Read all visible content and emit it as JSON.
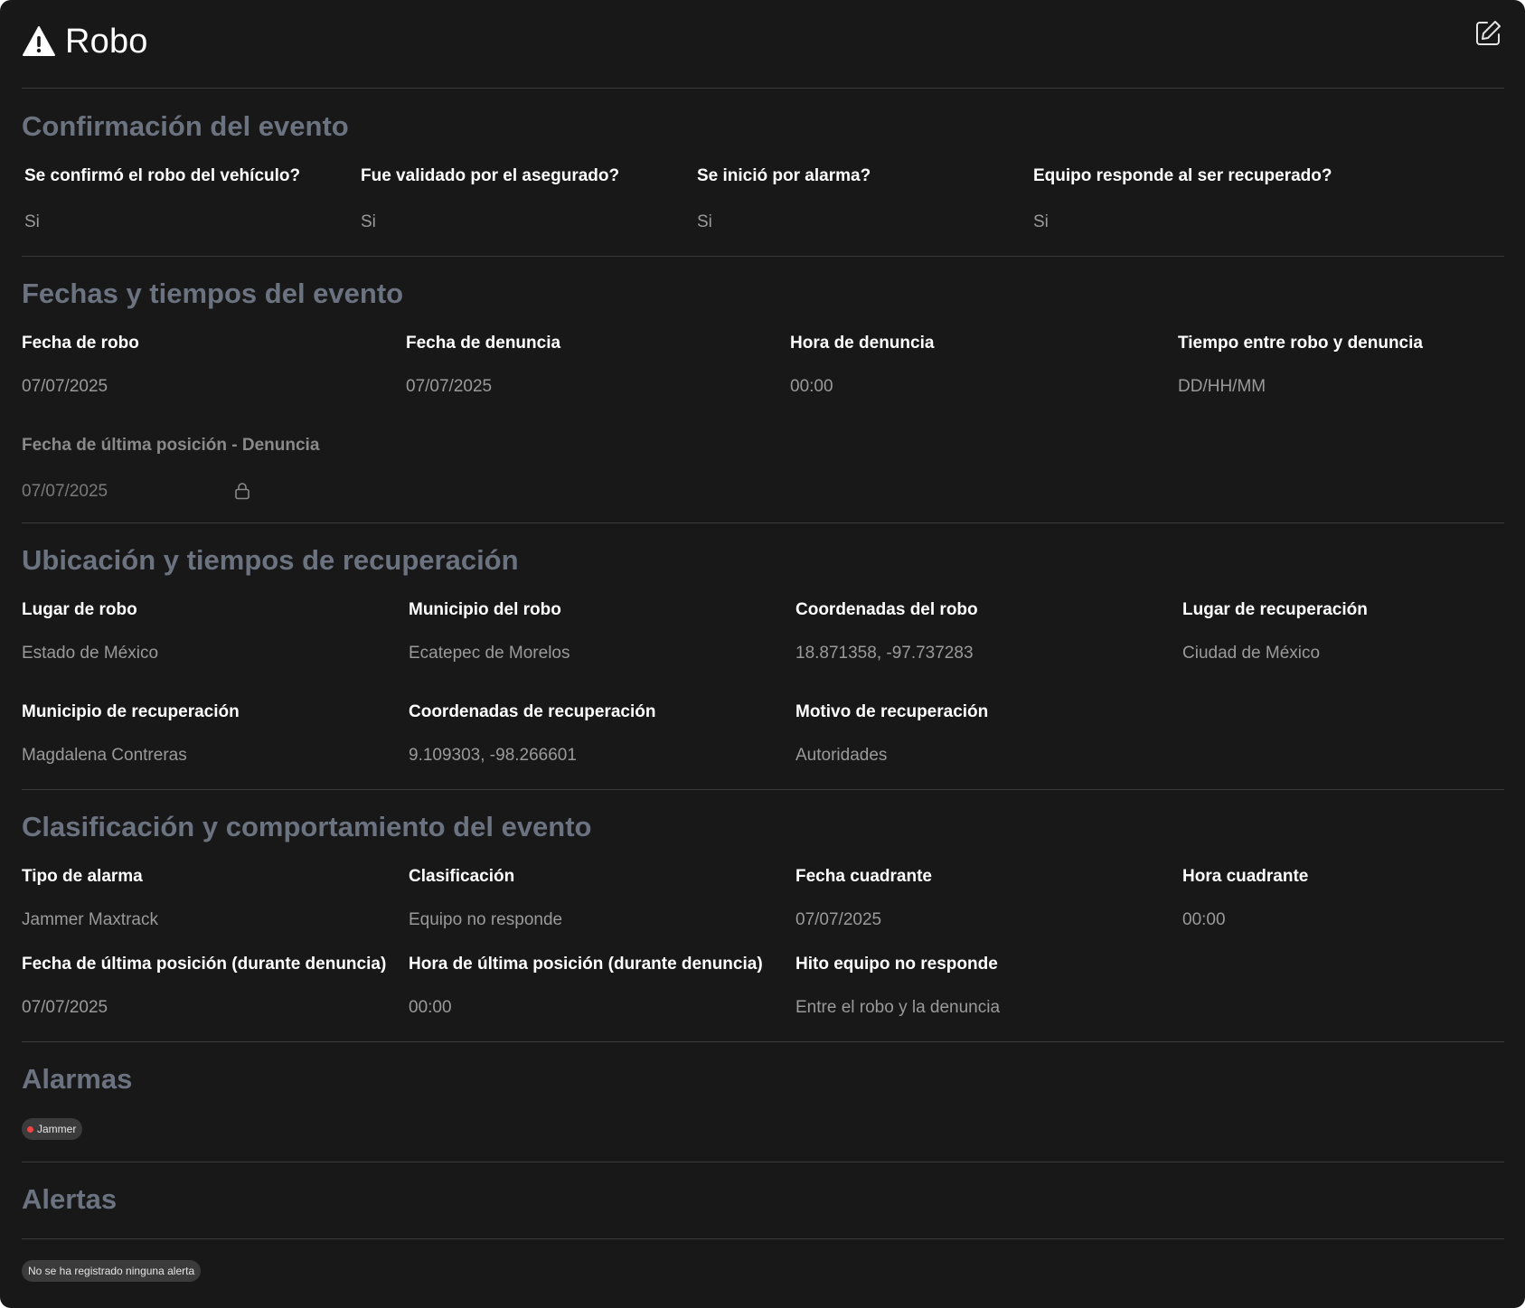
{
  "header": {
    "title": "Robo",
    "icon": "warning-icon",
    "edit_icon": "edit-icon"
  },
  "confirmacion": {
    "title": "Confirmación del evento",
    "fields": [
      {
        "label": "Se confirmó el robo del vehículo?",
        "value": "Si"
      },
      {
        "label": "Fue validado por el asegurado?",
        "value": "Si"
      },
      {
        "label": "Se inició por alarma?",
        "value": "Si"
      },
      {
        "label": "Equipo responde al ser recuperado?",
        "value": "Si"
      }
    ]
  },
  "fechas": {
    "title": "Fechas y tiempos del evento",
    "fields": [
      {
        "label": "Fecha de robo",
        "value": "07/07/2025"
      },
      {
        "label": "Fecha de denuncia",
        "value": "07/07/2025"
      },
      {
        "label": "Hora de denuncia",
        "value": "00:00"
      },
      {
        "label": "Tiempo entre robo y denuncia",
        "value": "DD/HH/MM"
      }
    ],
    "locked_field": {
      "label": "Fecha de última posición - Denuncia",
      "value": "07/07/2025",
      "icon": "lock-icon"
    }
  },
  "ubicacion": {
    "title": "Ubicación y tiempos de recuperación",
    "fields": [
      {
        "label": "Lugar de robo",
        "value": "Estado de México"
      },
      {
        "label": "Municipio del robo",
        "value": "Ecatepec de Morelos"
      },
      {
        "label": "Coordenadas del robo",
        "value": "18.871358, -97.737283"
      },
      {
        "label": "Lugar de recuperación",
        "value": "Ciudad de México"
      },
      {
        "label": "Municipio de recuperación",
        "value": "Magdalena Contreras"
      },
      {
        "label": "Coordenadas de recuperación",
        "value": "9.109303, -98.266601"
      },
      {
        "label": "Motivo de recuperación",
        "value": "Autoridades"
      }
    ]
  },
  "clasificacion": {
    "title": "Clasificación y comportamiento del evento",
    "fields": [
      {
        "label": "Tipo de alarma",
        "value": "Jammer Maxtrack"
      },
      {
        "label": "Clasificación",
        "value": "Equipo no responde"
      },
      {
        "label": "Fecha cuadrante",
        "value": "07/07/2025"
      },
      {
        "label": "Hora cuadrante",
        "value": "00:00"
      },
      {
        "label": "Fecha de última posición (durante denuncia)",
        "value": "07/07/2025"
      },
      {
        "label": "Hora de última posición (durante denuncia)",
        "value": "00:00"
      },
      {
        "label": "Hito equipo no responde",
        "value": "Entre el robo y la denuncia"
      }
    ]
  },
  "alarmas": {
    "title": "Alarmas",
    "chips": [
      {
        "label": "Jammer",
        "dot_color": "#ef4444"
      }
    ]
  },
  "alertas": {
    "title": "Alertas",
    "empty_text": "No se ha registrado ninguna alerta"
  },
  "colors": {
    "background": "#181818",
    "section_title": "#6b7280",
    "divider": "#3a3a3a",
    "alarm_dot": "#ef4444"
  }
}
